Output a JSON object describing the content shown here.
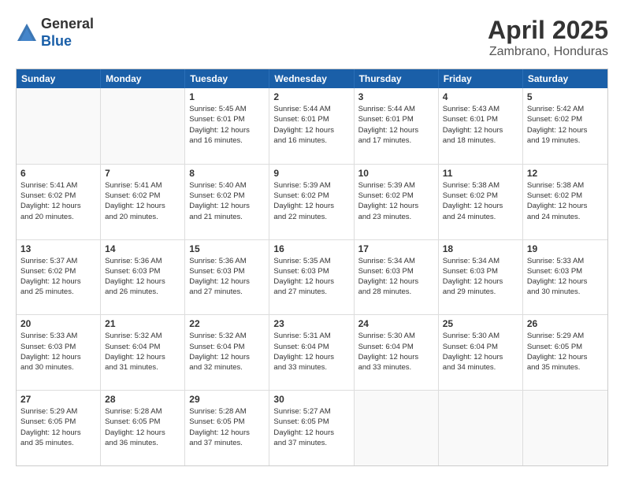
{
  "logo": {
    "general": "General",
    "blue": "Blue"
  },
  "title": "April 2025",
  "location": "Zambrano, Honduras",
  "header_days": [
    "Sunday",
    "Monday",
    "Tuesday",
    "Wednesday",
    "Thursday",
    "Friday",
    "Saturday"
  ],
  "weeks": [
    [
      {
        "day": "",
        "info": "",
        "empty": true
      },
      {
        "day": "",
        "info": "",
        "empty": true
      },
      {
        "day": "1",
        "info": "Sunrise: 5:45 AM\nSunset: 6:01 PM\nDaylight: 12 hours\nand 16 minutes."
      },
      {
        "day": "2",
        "info": "Sunrise: 5:44 AM\nSunset: 6:01 PM\nDaylight: 12 hours\nand 16 minutes."
      },
      {
        "day": "3",
        "info": "Sunrise: 5:44 AM\nSunset: 6:01 PM\nDaylight: 12 hours\nand 17 minutes."
      },
      {
        "day": "4",
        "info": "Sunrise: 5:43 AM\nSunset: 6:01 PM\nDaylight: 12 hours\nand 18 minutes."
      },
      {
        "day": "5",
        "info": "Sunrise: 5:42 AM\nSunset: 6:02 PM\nDaylight: 12 hours\nand 19 minutes."
      }
    ],
    [
      {
        "day": "6",
        "info": "Sunrise: 5:41 AM\nSunset: 6:02 PM\nDaylight: 12 hours\nand 20 minutes."
      },
      {
        "day": "7",
        "info": "Sunrise: 5:41 AM\nSunset: 6:02 PM\nDaylight: 12 hours\nand 20 minutes."
      },
      {
        "day": "8",
        "info": "Sunrise: 5:40 AM\nSunset: 6:02 PM\nDaylight: 12 hours\nand 21 minutes."
      },
      {
        "day": "9",
        "info": "Sunrise: 5:39 AM\nSunset: 6:02 PM\nDaylight: 12 hours\nand 22 minutes."
      },
      {
        "day": "10",
        "info": "Sunrise: 5:39 AM\nSunset: 6:02 PM\nDaylight: 12 hours\nand 23 minutes."
      },
      {
        "day": "11",
        "info": "Sunrise: 5:38 AM\nSunset: 6:02 PM\nDaylight: 12 hours\nand 24 minutes."
      },
      {
        "day": "12",
        "info": "Sunrise: 5:38 AM\nSunset: 6:02 PM\nDaylight: 12 hours\nand 24 minutes."
      }
    ],
    [
      {
        "day": "13",
        "info": "Sunrise: 5:37 AM\nSunset: 6:02 PM\nDaylight: 12 hours\nand 25 minutes."
      },
      {
        "day": "14",
        "info": "Sunrise: 5:36 AM\nSunset: 6:03 PM\nDaylight: 12 hours\nand 26 minutes."
      },
      {
        "day": "15",
        "info": "Sunrise: 5:36 AM\nSunset: 6:03 PM\nDaylight: 12 hours\nand 27 minutes."
      },
      {
        "day": "16",
        "info": "Sunrise: 5:35 AM\nSunset: 6:03 PM\nDaylight: 12 hours\nand 27 minutes."
      },
      {
        "day": "17",
        "info": "Sunrise: 5:34 AM\nSunset: 6:03 PM\nDaylight: 12 hours\nand 28 minutes."
      },
      {
        "day": "18",
        "info": "Sunrise: 5:34 AM\nSunset: 6:03 PM\nDaylight: 12 hours\nand 29 minutes."
      },
      {
        "day": "19",
        "info": "Sunrise: 5:33 AM\nSunset: 6:03 PM\nDaylight: 12 hours\nand 30 minutes."
      }
    ],
    [
      {
        "day": "20",
        "info": "Sunrise: 5:33 AM\nSunset: 6:03 PM\nDaylight: 12 hours\nand 30 minutes."
      },
      {
        "day": "21",
        "info": "Sunrise: 5:32 AM\nSunset: 6:04 PM\nDaylight: 12 hours\nand 31 minutes."
      },
      {
        "day": "22",
        "info": "Sunrise: 5:32 AM\nSunset: 6:04 PM\nDaylight: 12 hours\nand 32 minutes."
      },
      {
        "day": "23",
        "info": "Sunrise: 5:31 AM\nSunset: 6:04 PM\nDaylight: 12 hours\nand 33 minutes."
      },
      {
        "day": "24",
        "info": "Sunrise: 5:30 AM\nSunset: 6:04 PM\nDaylight: 12 hours\nand 33 minutes."
      },
      {
        "day": "25",
        "info": "Sunrise: 5:30 AM\nSunset: 6:04 PM\nDaylight: 12 hours\nand 34 minutes."
      },
      {
        "day": "26",
        "info": "Sunrise: 5:29 AM\nSunset: 6:05 PM\nDaylight: 12 hours\nand 35 minutes."
      }
    ],
    [
      {
        "day": "27",
        "info": "Sunrise: 5:29 AM\nSunset: 6:05 PM\nDaylight: 12 hours\nand 35 minutes."
      },
      {
        "day": "28",
        "info": "Sunrise: 5:28 AM\nSunset: 6:05 PM\nDaylight: 12 hours\nand 36 minutes."
      },
      {
        "day": "29",
        "info": "Sunrise: 5:28 AM\nSunset: 6:05 PM\nDaylight: 12 hours\nand 37 minutes."
      },
      {
        "day": "30",
        "info": "Sunrise: 5:27 AM\nSunset: 6:05 PM\nDaylight: 12 hours\nand 37 minutes."
      },
      {
        "day": "",
        "info": "",
        "empty": true
      },
      {
        "day": "",
        "info": "",
        "empty": true
      },
      {
        "day": "",
        "info": "",
        "empty": true
      }
    ]
  ]
}
